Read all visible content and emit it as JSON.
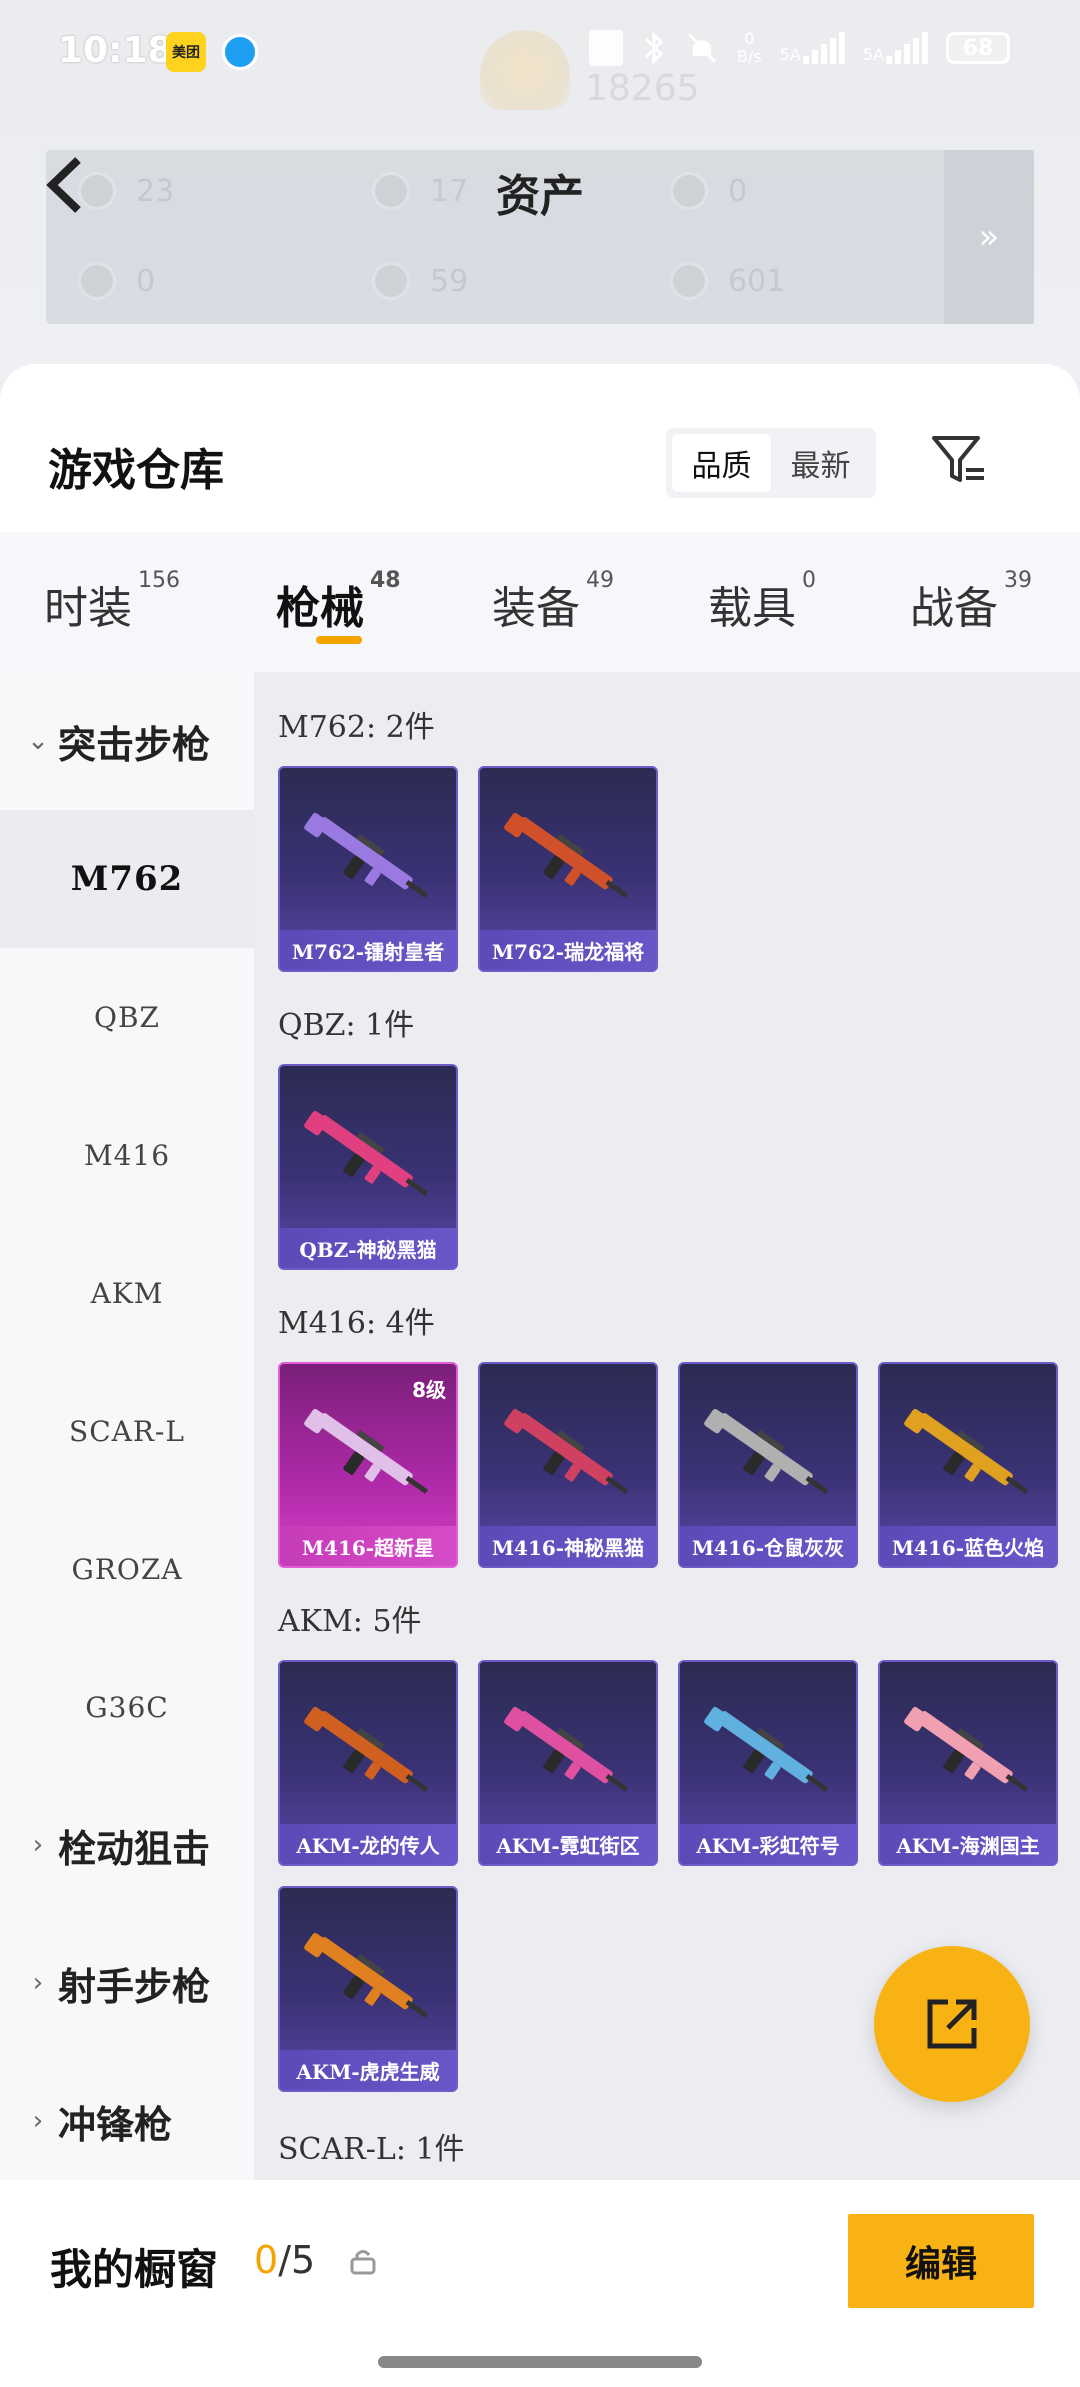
{
  "status_bar": {
    "time": "10:18",
    "meituan_label": "美团",
    "net_speed_top": "0",
    "net_speed_bottom": "B/s",
    "signal_label_1": "5A",
    "signal_label_2": "5A",
    "battery": "68"
  },
  "assets": {
    "title": "资产",
    "items": [
      {
        "value": "23"
      },
      {
        "value": "17"
      },
      {
        "value": "0"
      },
      {
        "value": "0"
      },
      {
        "value": "59"
      },
      {
        "value": "601"
      }
    ],
    "bg_score": "18265"
  },
  "warehouse": {
    "title": "游戏仓库",
    "sort_options": [
      "品质",
      "最新"
    ],
    "sort_active": "品质"
  },
  "tabs": [
    {
      "label": "时装",
      "count": "156"
    },
    {
      "label": "枪械",
      "count": "48"
    },
    {
      "label": "装备",
      "count": "49"
    },
    {
      "label": "载具",
      "count": "0"
    },
    {
      "label": "战备",
      "count": "39"
    }
  ],
  "sidebar": {
    "cat_assault": "突击步枪",
    "subs": [
      "M762",
      "QBZ",
      "M416",
      "AKM",
      "SCAR-L",
      "GROZA",
      "G36C"
    ],
    "cat_sniper": "栓动狙击",
    "cat_marksman": "射手步枪",
    "cat_smg": "冲锋枪"
  },
  "groups": [
    {
      "label": "M762: 2件",
      "items": [
        {
          "name": "M762-镭射皇者",
          "color": "#9a7ae0"
        },
        {
          "name": "M762-瑞龙福将",
          "color": "#d0502a"
        }
      ]
    },
    {
      "label": "QBZ: 1件",
      "items": [
        {
          "name": "QBZ-神秘黑猫",
          "color": "#e04080"
        }
      ]
    },
    {
      "label": "M416: 4件",
      "items": [
        {
          "name": "M416-超新星",
          "level": "8级",
          "color": "#e0c0e8"
        },
        {
          "name": "M416-神秘黑猫",
          "color": "#d04060"
        },
        {
          "name": "M416-仓鼠灰灰",
          "color": "#b0b0b0"
        },
        {
          "name": "M416-蓝色火焰",
          "color": "#e0a020"
        }
      ]
    },
    {
      "label": "AKM: 5件",
      "items": [
        {
          "name": "AKM-龙的传人",
          "color": "#d06020"
        },
        {
          "name": "AKM-霓虹街区",
          "color": "#e050a0"
        },
        {
          "name": "AKM-彩虹符号",
          "color": "#60b0e0"
        },
        {
          "name": "AKM-海渊国主",
          "color": "#f0a0b0"
        },
        {
          "name": "AKM-虎虎生威",
          "color": "#e08020"
        }
      ]
    },
    {
      "label": "SCAR-L: 1件",
      "items": []
    }
  ],
  "showcase": {
    "label": "我的橱窗",
    "current": "0",
    "total": "/5"
  },
  "edit_label": "编辑"
}
